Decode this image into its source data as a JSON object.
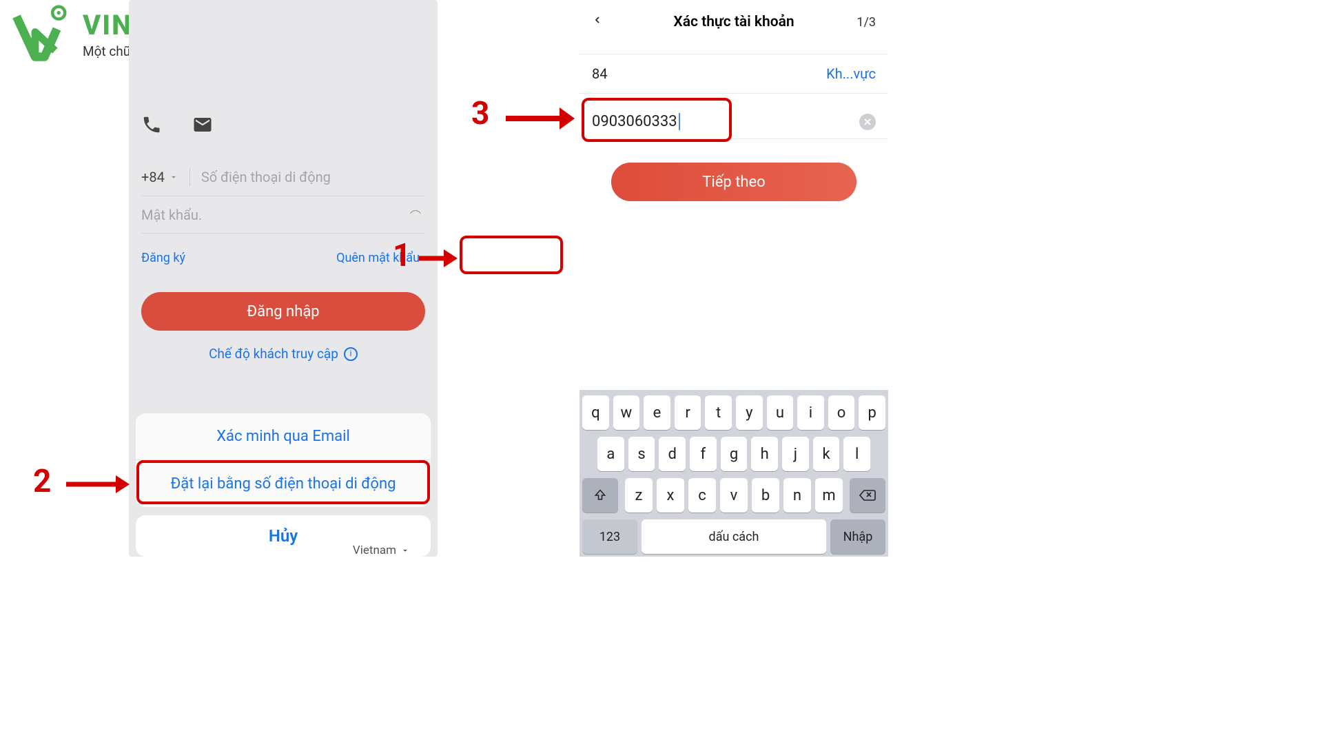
{
  "logo": {
    "title": "VINA CCTV",
    "subtitle": "Một chữ tín - Vạn niềm tin"
  },
  "left": {
    "cc_prefix": "+84",
    "phone_placeholder": "Số điện thoại di động",
    "password_placeholder": "Mật khẩu.",
    "signup_link": "Đăng ký",
    "forgot_link": "Quên mật khẩu",
    "login_button": "Đăng nhập",
    "guest_mode": "Chế độ khách truy cập",
    "sheet": {
      "email": "Xác minh qua Email",
      "phone": "Đặt lại bằng số điện thoại di động",
      "cancel": "Hủy"
    },
    "language": "Vietnam"
  },
  "right": {
    "title": "Xác thực tài khoản",
    "step": "1/3",
    "cc_value": "84",
    "region_link": "Kh...vực",
    "phone_value": "0903060333",
    "next_button": "Tiếp theo",
    "keyboard": {
      "row1": [
        "q",
        "w",
        "e",
        "r",
        "t",
        "y",
        "u",
        "i",
        "o",
        "p"
      ],
      "row2": [
        "a",
        "s",
        "d",
        "f",
        "g",
        "h",
        "j",
        "k",
        "l"
      ],
      "row3": [
        "z",
        "x",
        "c",
        "v",
        "b",
        "n",
        "m"
      ],
      "k123": "123",
      "space": "dấu cách",
      "enter": "Nhập"
    }
  },
  "annotations": {
    "n1": "1",
    "n2": "2",
    "n3": "3"
  }
}
